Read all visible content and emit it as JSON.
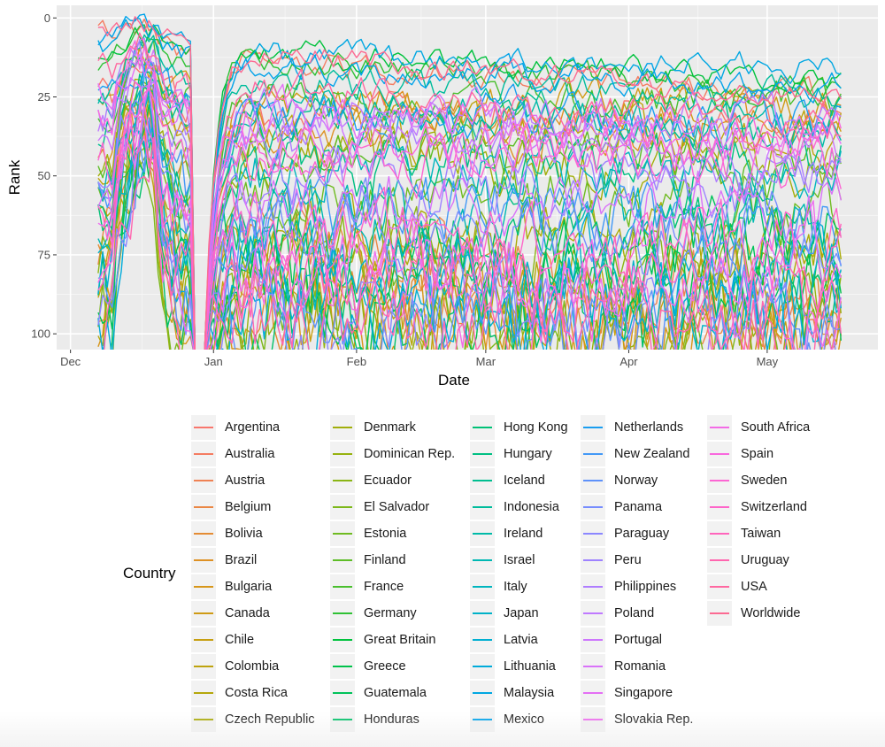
{
  "chart_data": {
    "type": "line",
    "title": "",
    "xlabel": "Date",
    "ylabel": "Rank",
    "y_reversed": true,
    "ylim": [
      -4,
      105
    ],
    "y_ticks": [
      0,
      25,
      50,
      75,
      100
    ],
    "x_ticks": [
      "Dec",
      "Jan",
      "Feb",
      "Mar",
      "Apr",
      "May"
    ],
    "x_tick_dates": [
      "2017-12-01",
      "2018-01-01",
      "2018-02-01",
      "2018-03-01",
      "2018-04-01",
      "2018-05-01"
    ],
    "x_range": [
      "2017-11-28",
      "2018-05-25"
    ],
    "data_date_range": [
      "2017-12-07",
      "2018-05-17"
    ],
    "grid": true,
    "legend": {
      "title": "Country",
      "placement": "bottom",
      "columns": 5
    },
    "note": "62 overlapping daily rank series; per-day values not individually legible. Each series carries approximate readable anchor ranks (start, typical level, end).",
    "series": [
      {
        "name": "Argentina",
        "color": "#F8766D",
        "start": 20,
        "level": 30,
        "end": 33
      },
      {
        "name": "Australia",
        "color": "#F47C61",
        "start": 5,
        "level": 12,
        "end": 25
      },
      {
        "name": "Austria",
        "color": "#EF8254",
        "start": 85,
        "level": 80,
        "end": 95
      },
      {
        "name": "Belgium",
        "color": "#EA8745",
        "start": 70,
        "level": 60,
        "end": 100
      },
      {
        "name": "Bolivia",
        "color": "#E48C34",
        "start": 60,
        "level": 95,
        "end": 102
      },
      {
        "name": "Brazil",
        "color": "#DE9124",
        "start": 40,
        "level": 35,
        "end": 33
      },
      {
        "name": "Bulgaria",
        "color": "#D7961A",
        "start": 95,
        "level": 100,
        "end": 104
      },
      {
        "name": "Canada",
        "color": "#CF9B15",
        "start": 30,
        "level": 27,
        "end": 30
      },
      {
        "name": "Chile",
        "color": "#C79F11",
        "start": 80,
        "level": 90,
        "end": 98
      },
      {
        "name": "Colombia",
        "color": "#BEA30E",
        "start": 50,
        "level": 40,
        "end": 37
      },
      {
        "name": "Costa Rica",
        "color": "#B5A70B",
        "start": 90,
        "level": 85,
        "end": 88
      },
      {
        "name": "Czech Republic",
        "color": "#ABAB09",
        "start": 70,
        "level": 65,
        "end": 75
      },
      {
        "name": "Denmark",
        "color": "#A1AE0B",
        "start": 55,
        "level": 45,
        "end": 48
      },
      {
        "name": "Dominican Rep.",
        "color": "#96B20F",
        "start": 100,
        "level": 95,
        "end": 102
      },
      {
        "name": "Ecuador",
        "color": "#8AB515",
        "start": 75,
        "level": 70,
        "end": 78
      },
      {
        "name": "El Salvador",
        "color": "#7DB81B",
        "start": 95,
        "level": 92,
        "end": 100
      },
      {
        "name": "Estonia",
        "color": "#6FBB21",
        "start": 60,
        "level": 55,
        "end": 60
      },
      {
        "name": "Finland",
        "color": "#5EBD27",
        "start": 45,
        "level": 42,
        "end": 45
      },
      {
        "name": "France",
        "color": "#4ABF2E",
        "start": 35,
        "level": 25,
        "end": 27
      },
      {
        "name": "Germany",
        "color": "#2FC135",
        "start": 15,
        "level": 12,
        "end": 24
      },
      {
        "name": "Great Britain",
        "color": "#00C23D",
        "start": 12,
        "level": 10,
        "end": 20
      },
      {
        "name": "Greece",
        "color": "#00C24B",
        "start": 88,
        "level": 85,
        "end": 82
      },
      {
        "name": "Guatemala",
        "color": "#00C25A",
        "start": 85,
        "level": 80,
        "end": 72
      },
      {
        "name": "Honduras",
        "color": "#00C168",
        "start": 100,
        "level": 96,
        "end": 104
      },
      {
        "name": "Hong Kong",
        "color": "#00C176",
        "start": 65,
        "level": 68,
        "end": 70
      },
      {
        "name": "Hungary",
        "color": "#00BF83",
        "start": 55,
        "level": 50,
        "end": 45
      },
      {
        "name": "Iceland",
        "color": "#00BE90",
        "start": 35,
        "level": 33,
        "end": 35
      },
      {
        "name": "Indonesia",
        "color": "#00BC9C",
        "start": 25,
        "level": 20,
        "end": 25
      },
      {
        "name": "Ireland",
        "color": "#00BAA8",
        "start": 28,
        "level": 26,
        "end": 38
      },
      {
        "name": "Israel",
        "color": "#00B8B3",
        "start": 70,
        "level": 65,
        "end": 62
      },
      {
        "name": "Italy",
        "color": "#00B5BE",
        "start": 50,
        "level": 48,
        "end": 50
      },
      {
        "name": "Japan",
        "color": "#00B2C8",
        "start": 75,
        "level": 82,
        "end": 90
      },
      {
        "name": "Latvia",
        "color": "#00AFD1",
        "start": 80,
        "level": 78,
        "end": 85
      },
      {
        "name": "Lithuania",
        "color": "#00ABDA",
        "start": 90,
        "level": 92,
        "end": 98
      },
      {
        "name": "Malaysia",
        "color": "#00A7E2",
        "start": 8,
        "level": 12,
        "end": 16
      },
      {
        "name": "Mexico",
        "color": "#00A2EA",
        "start": 10,
        "level": 14,
        "end": 22
      },
      {
        "name": "Netherlands",
        "color": "#1A9DF0",
        "start": 20,
        "level": 30,
        "end": 34
      },
      {
        "name": "New Zealand",
        "color": "#4298F6",
        "start": 60,
        "level": 60,
        "end": 65
      },
      {
        "name": "Norway",
        "color": "#5E92FA",
        "start": 85,
        "level": 95,
        "end": 100
      },
      {
        "name": "Panama",
        "color": "#778DFE",
        "start": 55,
        "level": 65,
        "end": 70
      },
      {
        "name": "Paraguay",
        "color": "#8B87FF",
        "start": 95,
        "level": 98,
        "end": 104
      },
      {
        "name": "Peru",
        "color": "#9E82FF",
        "start": 45,
        "level": 50,
        "end": 55
      },
      {
        "name": "Philippines",
        "color": "#AF7DFF",
        "start": 30,
        "level": 38,
        "end": 48
      },
      {
        "name": "Poland",
        "color": "#BF79FF",
        "start": 35,
        "level": 30,
        "end": 32
      },
      {
        "name": "Portugal",
        "color": "#CD76FD",
        "start": 40,
        "level": 36,
        "end": 40
      },
      {
        "name": "Romania",
        "color": "#D972F9",
        "start": 65,
        "level": 60,
        "end": 58
      },
      {
        "name": "Singapore",
        "color": "#E46FF4",
        "start": 25,
        "level": 30,
        "end": 36
      },
      {
        "name": "Slovakia Rep.",
        "color": "#ED6DEE",
        "start": 70,
        "level": 75,
        "end": 80
      },
      {
        "name": "South Africa",
        "color": "#F36BE6",
        "start": 80,
        "level": 85,
        "end": 92
      },
      {
        "name": "Spain",
        "color": "#F968DE",
        "start": 30,
        "level": 40,
        "end": 38
      },
      {
        "name": "Sweden",
        "color": "#FC66D3",
        "start": 50,
        "level": 45,
        "end": 43
      },
      {
        "name": "Switzerland",
        "color": "#FE65C9",
        "start": 60,
        "level": 70,
        "end": 75
      },
      {
        "name": "Taiwan",
        "color": "#FF65BC",
        "start": 90,
        "level": 88,
        "end": 86
      },
      {
        "name": "Uruguay",
        "color": "#FF66AF",
        "start": 100,
        "level": 95,
        "end": 100
      },
      {
        "name": "USA",
        "color": "#FF68A1",
        "start": 18,
        "level": 22,
        "end": 35
      },
      {
        "name": "Worldwide",
        "color": "#FC6A92",
        "start": 1,
        "level": 10,
        "end": 26
      }
    ]
  },
  "legend_title": "Country",
  "legend_columns": [
    [
      "Argentina",
      "Australia",
      "Austria",
      "Belgium",
      "Bolivia",
      "Brazil",
      "Bulgaria",
      "Canada",
      "Chile",
      "Colombia",
      "Costa Rica",
      "Czech Republic"
    ],
    [
      "Denmark",
      "Dominican Rep.",
      "Ecuador",
      "El Salvador",
      "Estonia",
      "Finland",
      "France",
      "Germany",
      "Great Britain",
      "Greece",
      "Guatemala",
      "Honduras"
    ],
    [
      "Hong Kong",
      "Hungary",
      "Iceland",
      "Indonesia",
      "Ireland",
      "Israel",
      "Italy",
      "Japan",
      "Latvia",
      "Lithuania",
      "Malaysia",
      "Mexico"
    ],
    [
      "Netherlands",
      "New Zealand",
      "Norway",
      "Panama",
      "Paraguay",
      "Peru",
      "Philippines",
      "Poland",
      "Portugal",
      "Romania",
      "Singapore",
      "Slovakia Rep."
    ],
    [
      "South Africa",
      "Spain",
      "Sweden",
      "Switzerland",
      "Taiwan",
      "Uruguay",
      "USA",
      "Worldwide"
    ]
  ]
}
